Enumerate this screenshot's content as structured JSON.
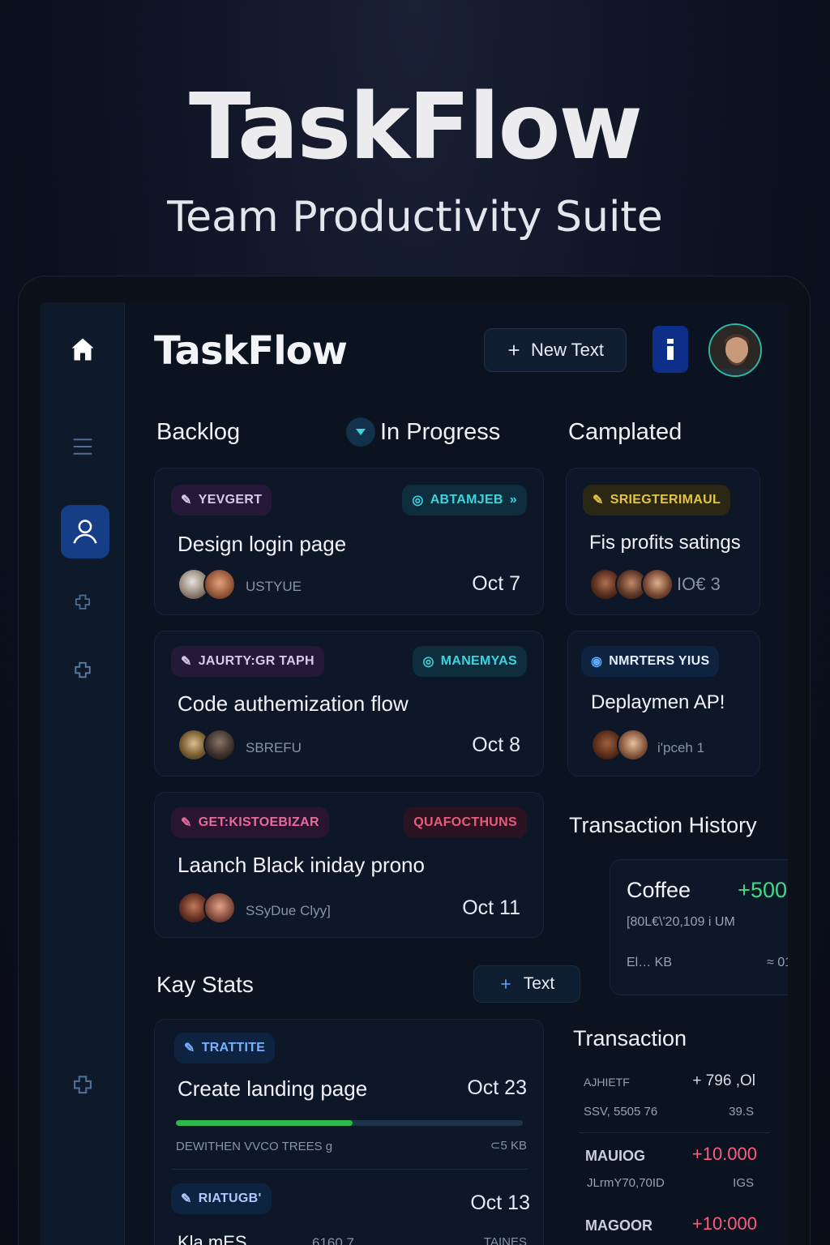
{
  "hero": {
    "title": "TaskFlow",
    "subtitle": "Team Productivity Suite"
  },
  "header": {
    "app_title": "TaskFlow",
    "new_button_label": "New Text",
    "new_button_icon": "plus-icon",
    "info_button_icon": "info-icon"
  },
  "sidebar": {
    "items": [
      {
        "icon": "home-icon"
      },
      {
        "icon": "menu-icon"
      },
      {
        "icon": "user-icon",
        "active": true
      },
      {
        "icon": "puzzle-icon"
      },
      {
        "icon": "puzzle-icon"
      },
      {
        "icon": "puzzle-icon"
      }
    ]
  },
  "columns": {
    "backlog": "Backlog",
    "in_progress": "In Progress",
    "completed": "Camplated"
  },
  "backlog_cards": [
    {
      "tag_left": "YEVGERT",
      "tag_right": "ABTAMJEB",
      "title": "Design login page",
      "meta": "USTYUE",
      "date": "Oct 7"
    },
    {
      "tag_left": "JAURTY:GR TAPH",
      "tag_right": "MANEMYAS",
      "title": "Code authemization flow",
      "meta": "SBREFU",
      "date": "Oct 8"
    },
    {
      "tag_left": "GET:KISTOEBIZAR",
      "tag_right": "QUAFOCTHUNS",
      "title": "Laanch Black iniday prono",
      "meta": "SSyDue Clyy]",
      "date": "Oct 11"
    }
  ],
  "completed_cards": [
    {
      "tag": "SRIEGTERIMAUL",
      "title": "Fis profits satings",
      "meta": "IO€ 3"
    },
    {
      "tag": "NMRTERS YIUS",
      "title": "Deplaymen AP!",
      "meta": "i'pceh 1"
    }
  ],
  "stats": {
    "heading": "Kay Stats",
    "add_button_label": "Text",
    "card1": {
      "tag": "TRATTITE",
      "title": "Create landing page",
      "date": "Oct 23",
      "progress": 0.51,
      "meta_left": "DEWITHEN  VVCO TREES  g",
      "meta_right": "⊂5 KB"
    },
    "card2": {
      "tag": "RIATUGB'",
      "date": "Oct 13",
      "title_partial": "Kla mES",
      "meta_mid": "6160 7",
      "meta_right": "TAINES"
    }
  },
  "transaction_history": {
    "heading": "Transaction History",
    "item": {
      "name": "Coffee",
      "amount": "+500",
      "detail": "[80L€\\'20,109 i  UM",
      "foot_left": "El… KB",
      "foot_right": "≈ 01"
    }
  },
  "transaction": {
    "heading": "Transaction",
    "rows": [
      {
        "label": "AJHIETF",
        "amount": "+ 796 ,Ol",
        "sub_left": "SSV, 5505 76",
        "sub_right": "39.S"
      },
      {
        "label": "MAUIOG",
        "amount": "+10.000",
        "sub_left": "JLrmY70,70ID",
        "sub_right": "IGS"
      },
      {
        "label": "MAGOOR",
        "amount": "+10:000"
      }
    ]
  },
  "colors": {
    "accent_blue": "#163e86",
    "teal": "#3fd3e0",
    "green_amount": "#3ddc84",
    "red_amount": "#ff5c7a",
    "progress_green": "#2db84b"
  }
}
